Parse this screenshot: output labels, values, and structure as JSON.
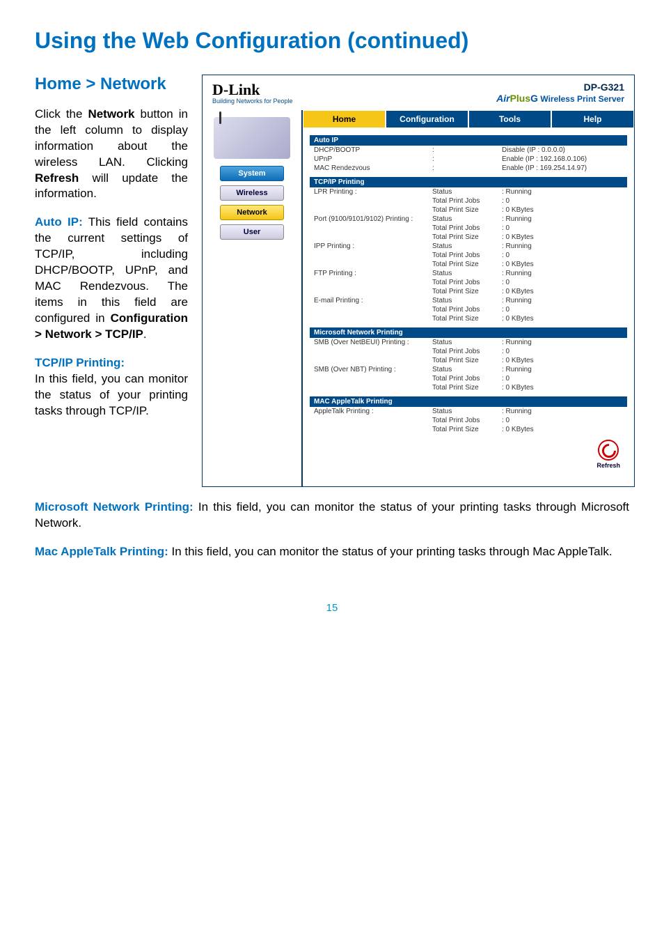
{
  "page_title": "Using the Web Configuration (continued)",
  "section_title": "Home > Network",
  "intro_para": {
    "pre": "Click the ",
    "bold1": "Network",
    "mid1": " button in the left column to display information about the wireless LAN. Clicking ",
    "bold2": "Refresh",
    "mid2": " will update the information."
  },
  "auto_ip": {
    "label": "Auto IP:",
    "text": " This field contains the current settings of TCP/IP, including DHCP/BOOTP, UPnP, and MAC Rendezvous. The items in this field are configured in ",
    "bold_path": "Configuration > Network > TCP/IP",
    "end": "."
  },
  "tcpip_printing": {
    "label": "TCP/IP Printing:",
    "text": "In this field, you can monitor the status of your printing tasks through TCP/IP."
  },
  "ms_printing": {
    "label": "Microsoft Network Printing:",
    "text": " In this field, you can monitor the status of your printing tasks through Microsoft Network."
  },
  "mac_printing": {
    "label": "Mac AppleTalk Printing:",
    "text": " In this field, you can monitor the status of your printing tasks through Mac AppleTalk."
  },
  "page_number": "15",
  "screenshot": {
    "logo": "D-Link",
    "logo_sub": "Building Networks for People",
    "model": "DP-G321",
    "airplus": {
      "air": "Air",
      "plus": "Plus",
      "g": "G",
      "rest": " Wireless Print Server"
    },
    "sidebar": {
      "system": "System",
      "wireless": "Wireless",
      "network": "Network",
      "user": "User"
    },
    "tabs": {
      "home": "Home",
      "config": "Configuration",
      "tools": "Tools",
      "help": "Help"
    },
    "sections": {
      "auto_ip": {
        "title": "Auto IP",
        "rows": [
          {
            "label": "DHCP/BOOTP",
            "value": "Disable  (IP : 0.0.0.0)"
          },
          {
            "label": "UPnP",
            "value": "Enable  (IP : 192.168.0.106)"
          },
          {
            "label": "MAC Rendezvous",
            "value": "Enable  (IP : 169.254.14.97)"
          }
        ]
      },
      "tcpip": {
        "title": "TCP/IP Printing",
        "groups": [
          {
            "label": "LPR Printing",
            "status": "Running",
            "jobs": "0",
            "size": "0 KBytes"
          },
          {
            "label": "Port (9100/9101/9102) Printing",
            "status": "Running",
            "jobs": "0",
            "size": "0 KBytes"
          },
          {
            "label": "IPP Printing",
            "status": "Running",
            "jobs": "0",
            "size": "0 KBytes"
          },
          {
            "label": "FTP Printing",
            "status": "Running",
            "jobs": "0",
            "size": "0 KBytes"
          },
          {
            "label": "E-mail Printing",
            "status": "Running",
            "jobs": "0",
            "size": "0 KBytes"
          }
        ]
      },
      "ms": {
        "title": "Microsoft Network Printing",
        "groups": [
          {
            "label": "SMB (Over NetBEUI) Printing",
            "status": "Running",
            "jobs": "0",
            "size": "0 KBytes"
          },
          {
            "label": "SMB (Over NBT) Printing",
            "status": "Running",
            "jobs": "0",
            "size": "0 KBytes"
          }
        ]
      },
      "mac": {
        "title": "MAC AppleTalk Printing",
        "groups": [
          {
            "label": "AppleTalk Printing",
            "status": "Running",
            "jobs": "0",
            "size": "0 KBytes"
          }
        ]
      }
    },
    "labels": {
      "status": "Status",
      "jobs": "Total Print Jobs",
      "size": "Total Print Size"
    },
    "refresh": "Refresh"
  }
}
